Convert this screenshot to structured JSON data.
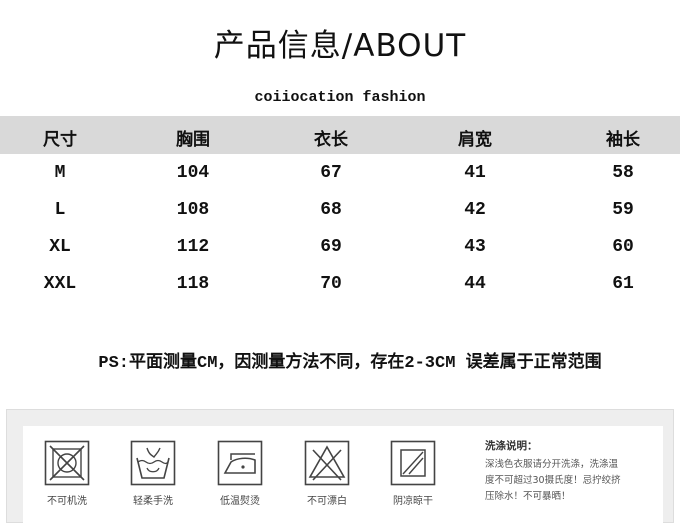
{
  "title": "产品信息/ABOUT",
  "brand": "coiiocation fashion",
  "table": {
    "headers": [
      "尺寸",
      "胸围",
      "衣长",
      "肩宽",
      "袖长"
    ],
    "rows": [
      [
        "M",
        "104",
        "67",
        "41",
        "58"
      ],
      [
        "L",
        "108",
        "68",
        "42",
        "59"
      ],
      [
        "XL",
        "112",
        "69",
        "43",
        "60"
      ],
      [
        "XXL",
        "118",
        "70",
        "44",
        "61"
      ]
    ]
  },
  "note": "PS:平面测量CM，因测量方法不同，存在2-3CM 误差属于正常范围",
  "care": {
    "items": [
      {
        "icon": "no-machine-wash-icon",
        "label": "不可机洗"
      },
      {
        "icon": "gentle-hand-wash-icon",
        "label": "轻柔手洗"
      },
      {
        "icon": "low-temp-iron-icon",
        "label": "低温熨烫"
      },
      {
        "icon": "no-bleach-icon",
        "label": "不可漂白"
      },
      {
        "icon": "shade-dry-icon",
        "label": "阴凉晾干"
      }
    ],
    "instructions_title": "洗涤说明：",
    "instructions_lines": [
      "深浅色衣服请分开洗涤，洗涤温",
      "度不可超过30摄氏度！忌拧绞挤",
      "压除水！不可暴晒！"
    ]
  }
}
